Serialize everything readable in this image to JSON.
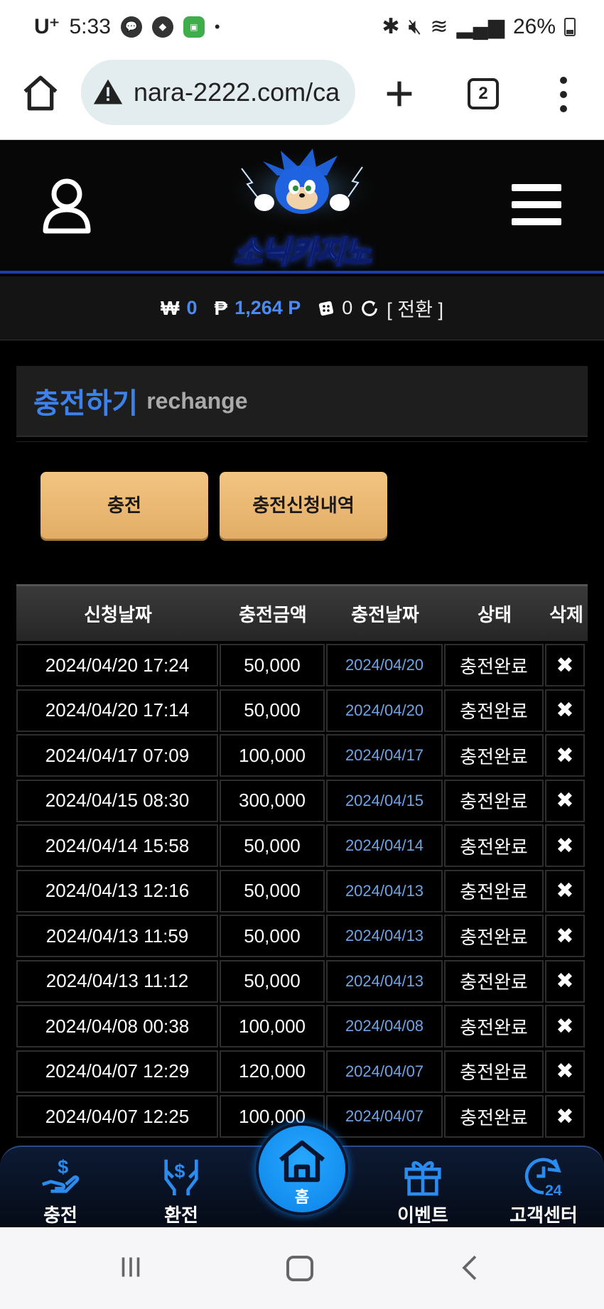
{
  "status_bar": {
    "carrier": "U⁺",
    "time": "5:33",
    "battery": "26%"
  },
  "browser": {
    "url": "nara-2222.com/ca",
    "tab_count": "2"
  },
  "site": {
    "logo_text": "소닉카지노"
  },
  "balance": {
    "won_symbol": "₩",
    "won_value": "0",
    "point_symbol": "₱",
    "point_value": "1,264 P",
    "chip_value": "0",
    "switch_label": "[ 전환 ]"
  },
  "page": {
    "title_kor": "충전하기",
    "title_eng": "rechange",
    "btn_charge": "충전",
    "btn_history": "충전신청내역"
  },
  "table": {
    "headers": [
      "신청날짜",
      "충전금액",
      "충전날짜",
      "상태",
      "삭제"
    ],
    "rows": [
      {
        "request_date": "2024/04/20 17:24",
        "amount": "50,000",
        "charge_date": "2024/04/20",
        "status": "충전완료",
        "delete": "✖"
      },
      {
        "request_date": "2024/04/20 17:14",
        "amount": "50,000",
        "charge_date": "2024/04/20",
        "status": "충전완료",
        "delete": "✖"
      },
      {
        "request_date": "2024/04/17 07:09",
        "amount": "100,000",
        "charge_date": "2024/04/17",
        "status": "충전완료",
        "delete": "✖"
      },
      {
        "request_date": "2024/04/15 08:30",
        "amount": "300,000",
        "charge_date": "2024/04/15",
        "status": "충전완료",
        "delete": "✖"
      },
      {
        "request_date": "2024/04/14 15:58",
        "amount": "50,000",
        "charge_date": "2024/04/14",
        "status": "충전완료",
        "delete": "✖"
      },
      {
        "request_date": "2024/04/13 12:16",
        "amount": "50,000",
        "charge_date": "2024/04/13",
        "status": "충전완료",
        "delete": "✖"
      },
      {
        "request_date": "2024/04/13 11:59",
        "amount": "50,000",
        "charge_date": "2024/04/13",
        "status": "충전완료",
        "delete": "✖"
      },
      {
        "request_date": "2024/04/13 11:12",
        "amount": "50,000",
        "charge_date": "2024/04/13",
        "status": "충전완료",
        "delete": "✖"
      },
      {
        "request_date": "2024/04/08 00:38",
        "amount": "100,000",
        "charge_date": "2024/04/08",
        "status": "충전완료",
        "delete": "✖"
      },
      {
        "request_date": "2024/04/07 12:29",
        "amount": "120,000",
        "charge_date": "2024/04/07",
        "status": "충전완료",
        "delete": "✖"
      },
      {
        "request_date": "2024/04/07 12:25",
        "amount": "100,000",
        "charge_date": "2024/04/07",
        "status": "충전완료",
        "delete": "✖"
      }
    ]
  },
  "bottom_nav": {
    "charge": "충전",
    "exchange": "환전",
    "home": "홈",
    "event": "이벤트",
    "customer_center": "고객센터"
  },
  "colors": {
    "accent_blue": "#3d82ea",
    "button_gold": "#e8b870",
    "header_line": "#1b3fa8"
  }
}
